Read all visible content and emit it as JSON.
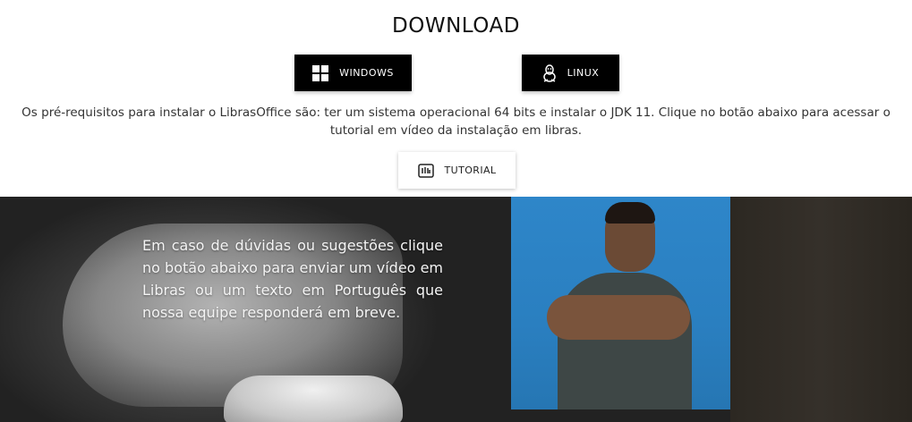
{
  "page": {
    "title": "DOWNLOAD"
  },
  "downloads": {
    "windows": {
      "label": "WINDOWS",
      "icon": "windows-icon"
    },
    "linux": {
      "label": "LINUX",
      "icon": "linux-tux-icon"
    }
  },
  "prerequisites": {
    "text": "Os pré-requisitos para instalar o LibrasOffice são: ter um sistema operacional 64 bits e instalar o JDK 11. Clique no botão abaixo para acessar o tutorial em vídeo da instalação em libras."
  },
  "tutorial": {
    "label": "TUTORIAL",
    "icon": "sign-language-icon"
  },
  "feedback": {
    "text": "Em caso de dúvidas ou sugestões clique no botão abaixo para enviar um vídeo em Libras ou um texto em Português que nossa equipe responderá em breve."
  },
  "colors": {
    "button_dark": "#000000",
    "video_background": "#2e86c9",
    "section_dark": "#2a2a2a"
  }
}
